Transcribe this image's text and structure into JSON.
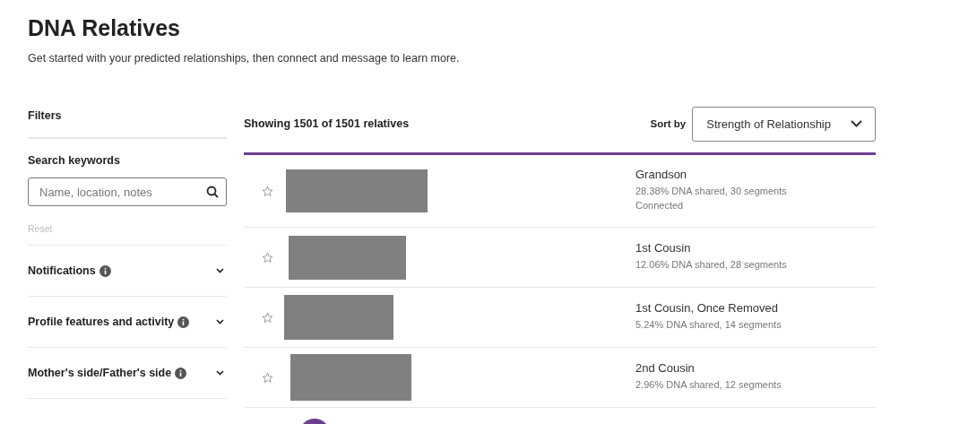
{
  "page": {
    "title": "DNA Relatives",
    "subtitle": "Get started with your predicted relationships, then connect and message to learn more."
  },
  "filters": {
    "heading": "Filters",
    "search_label": "Search keywords",
    "search": {
      "placeholder": "Name, location, notes"
    },
    "reset": "Reset",
    "sections": [
      {
        "label": "Notifications",
        "expanded": false
      },
      {
        "label": "Profile features and activity",
        "expanded": false
      },
      {
        "label": "Mother's side/Father's side",
        "expanded": false
      }
    ]
  },
  "results": {
    "summary": "Showing 1501 of 1501 relatives",
    "sort_label": "Sort by",
    "sort_value": "Strength of Relationship",
    "relatives": [
      {
        "starred": false,
        "relationship": "Grandson",
        "shared": "28.38% DNA shared, 30 segments",
        "status": "Connected"
      },
      {
        "starred": false,
        "relationship": "1st Cousin",
        "shared": "12.06% DNA shared, 28 segments"
      },
      {
        "starred": false,
        "relationship": "1st Cousin, Once Removed",
        "shared": "5.24% DNA shared, 14 segments"
      },
      {
        "starred": false,
        "relationship": "2nd Cousin",
        "shared": "2.96% DNA shared, 12 segments"
      }
    ]
  }
}
